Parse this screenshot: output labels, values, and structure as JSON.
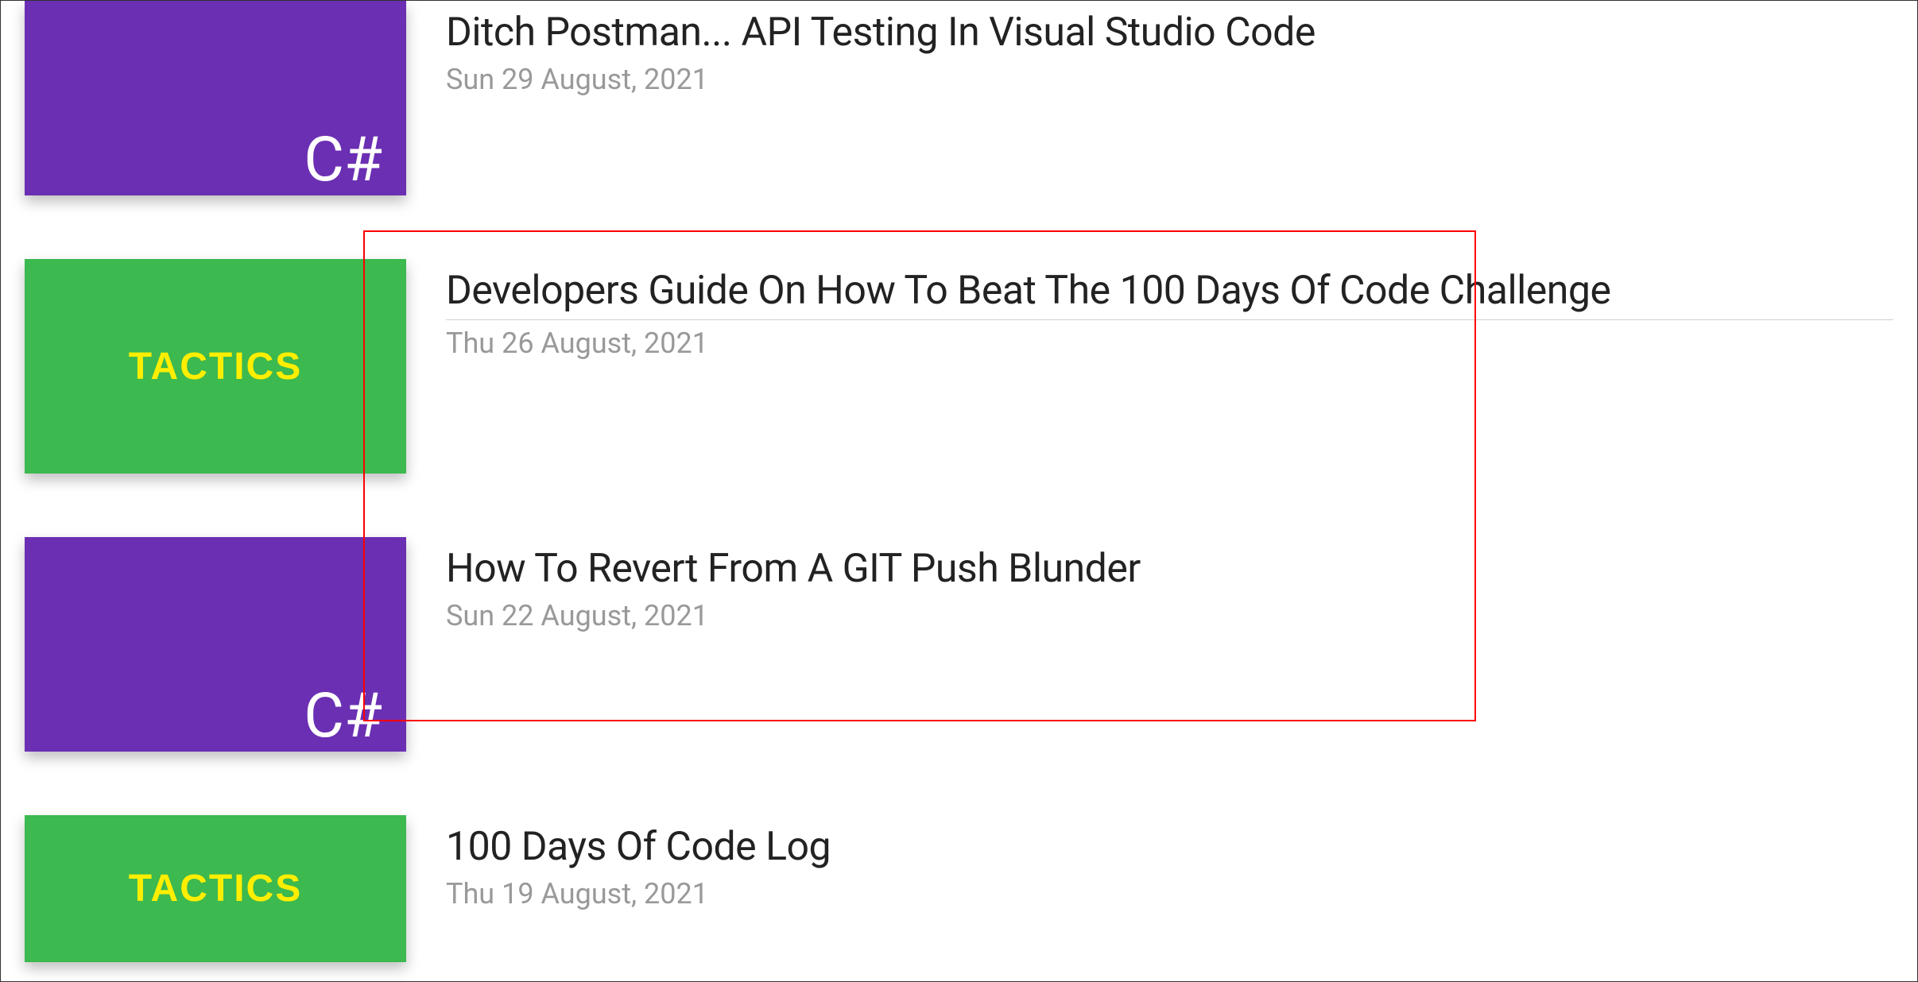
{
  "articles": [
    {
      "title": "Ditch Postman... API Testing In Visual Studio Code",
      "date": "Sun 29 August, 2021",
      "thumb_type": "csharp",
      "thumb_label": "C#",
      "underlined": false
    },
    {
      "title": "Developers Guide On How To Beat The 100 Days Of Code Challenge",
      "date": "Thu 26 August, 2021",
      "thumb_type": "tactics",
      "thumb_label": "TACTICS",
      "underlined": true
    },
    {
      "title": "How To Revert From A GIT Push Blunder",
      "date": "Sun 22 August, 2021",
      "thumb_type": "csharp",
      "thumb_label": "C#",
      "underlined": false
    },
    {
      "title": "100 Days Of Code Log",
      "date": "Thu 19 August, 2021",
      "thumb_type": "tactics",
      "thumb_label": "TACTICS",
      "underlined": false
    }
  ],
  "annotation": {
    "type": "red-box"
  }
}
